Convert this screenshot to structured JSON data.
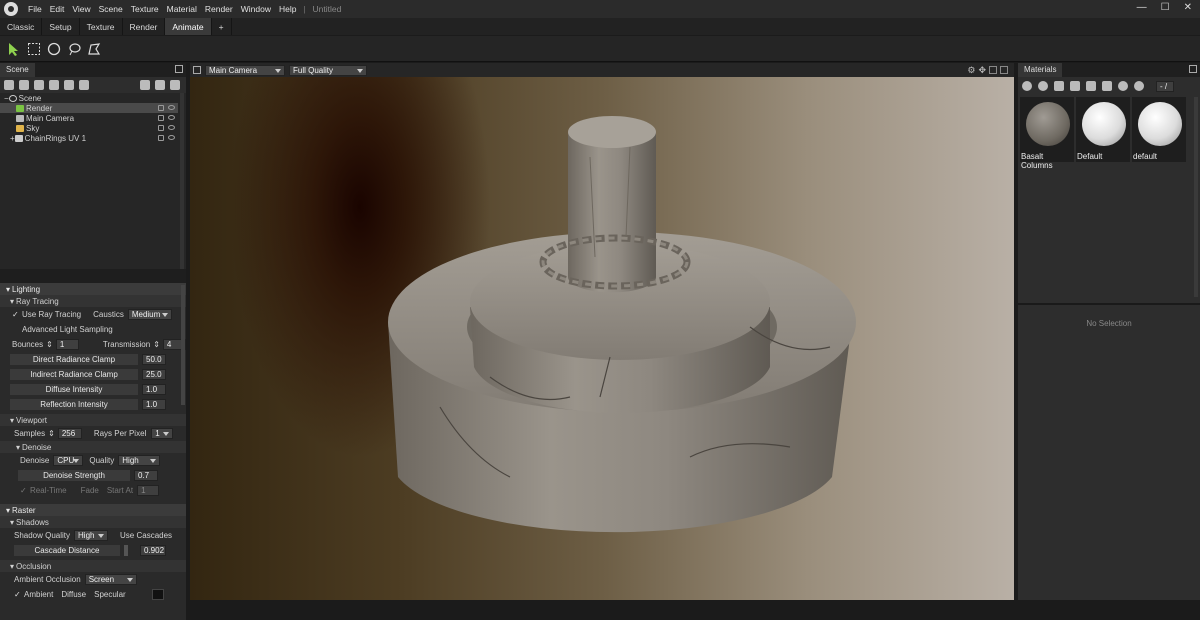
{
  "menubar": {
    "items": [
      "File",
      "Edit",
      "View",
      "Scene",
      "Texture",
      "Material",
      "Render",
      "Window",
      "Help"
    ],
    "doc_title": "Untitled"
  },
  "tabs": [
    "Classic",
    "Setup",
    "Texture",
    "Render",
    "Animate",
    "+"
  ],
  "active_tab": "Animate",
  "scene_panel": {
    "title": "Scene",
    "items": [
      "Scene",
      "Render",
      "Main Camera",
      "Sky",
      "ChainRings UV 1"
    ]
  },
  "lighting": {
    "title": "Lighting",
    "ray_tracing": {
      "title": "Ray Tracing",
      "use_ray_tracing": "Use Ray Tracing",
      "caustics_label": "Caustics",
      "caustics_value": "Medium",
      "advanced": "Advanced Light Sampling",
      "bounces_label": "Bounces",
      "bounces_value": "1",
      "transmission_label": "Transmission",
      "transmission_value": "4",
      "rows": [
        {
          "label": "Direct Radiance Clamp",
          "value": "50.0"
        },
        {
          "label": "Indirect Radiance Clamp",
          "value": "25.0"
        },
        {
          "label": "Diffuse Intensity",
          "value": "1.0"
        },
        {
          "label": "Reflection Intensity",
          "value": "1.0"
        }
      ]
    },
    "viewport": {
      "title": "Viewport",
      "samples_label": "Samples",
      "samples_value": "256",
      "rays_label": "Rays Per Pixel",
      "rays_value": "1",
      "denoise": {
        "title": "Denoise",
        "denoise_label": "Denoise",
        "denoise_value": "CPU",
        "quality_label": "Quality",
        "quality_value": "High",
        "strength_label": "Denoise Strength",
        "strength_value": "0.7",
        "realtime": "Real-Time",
        "fade": "Fade",
        "start_at": "Start At",
        "start_value": "1"
      }
    }
  },
  "raster": {
    "title": "Raster",
    "shadows": {
      "title": "Shadows",
      "quality_label": "Shadow Quality",
      "quality_value": "High",
      "use_cascades": "Use Cascades",
      "cascade_label": "Cascade Distance",
      "cascade_value": "0.902"
    },
    "occlusion": {
      "title": "Occlusion",
      "ao_label": "Ambient Occlusion",
      "ao_value": "Screen",
      "ambient": "Ambient",
      "diffuse": "Diffuse",
      "specular": "Specular"
    }
  },
  "viewport_bar": {
    "camera": "Main Camera",
    "quality": "Full Quality"
  },
  "materials": {
    "title": "Materials",
    "page": "- /",
    "items": [
      "Basalt Columns",
      "Default",
      "default"
    ],
    "no_selection": "No Selection"
  }
}
